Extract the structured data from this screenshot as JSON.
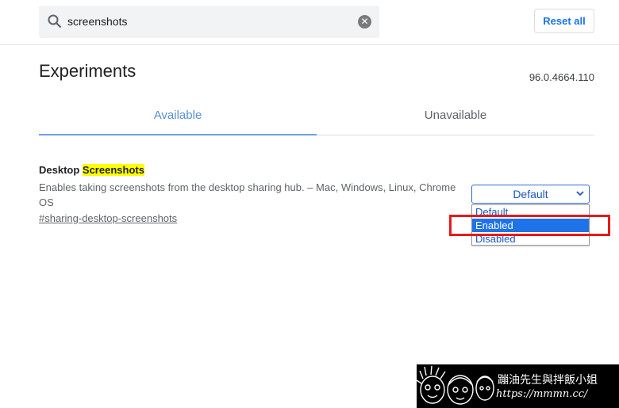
{
  "search": {
    "value": "screenshots",
    "placeholder": "Search flags"
  },
  "header": {
    "reset_label": "Reset all"
  },
  "page": {
    "title": "Experiments",
    "version": "96.0.4664.110"
  },
  "tabs": [
    {
      "label": "Available",
      "active": true
    },
    {
      "label": "Unavailable",
      "active": false
    }
  ],
  "experiment": {
    "name_prefix": "Desktop ",
    "name_highlight": "Screenshots",
    "description": "Enables taking screenshots from the desktop sharing hub. – Mac, Windows, Linux, Chrome OS",
    "link": "#sharing-desktop-screenshots",
    "select_value": "Default",
    "options": [
      "Default",
      "Enabled",
      "Disabled"
    ],
    "highlighted_option": "Enabled"
  },
  "watermark": {
    "line1": "蹦油先生與拌飯小姐",
    "line2": "https://mmmn.cc/"
  },
  "colors": {
    "accent": "#1a73e8",
    "highlight": "#ffff00",
    "annotation": "#e8191a"
  }
}
